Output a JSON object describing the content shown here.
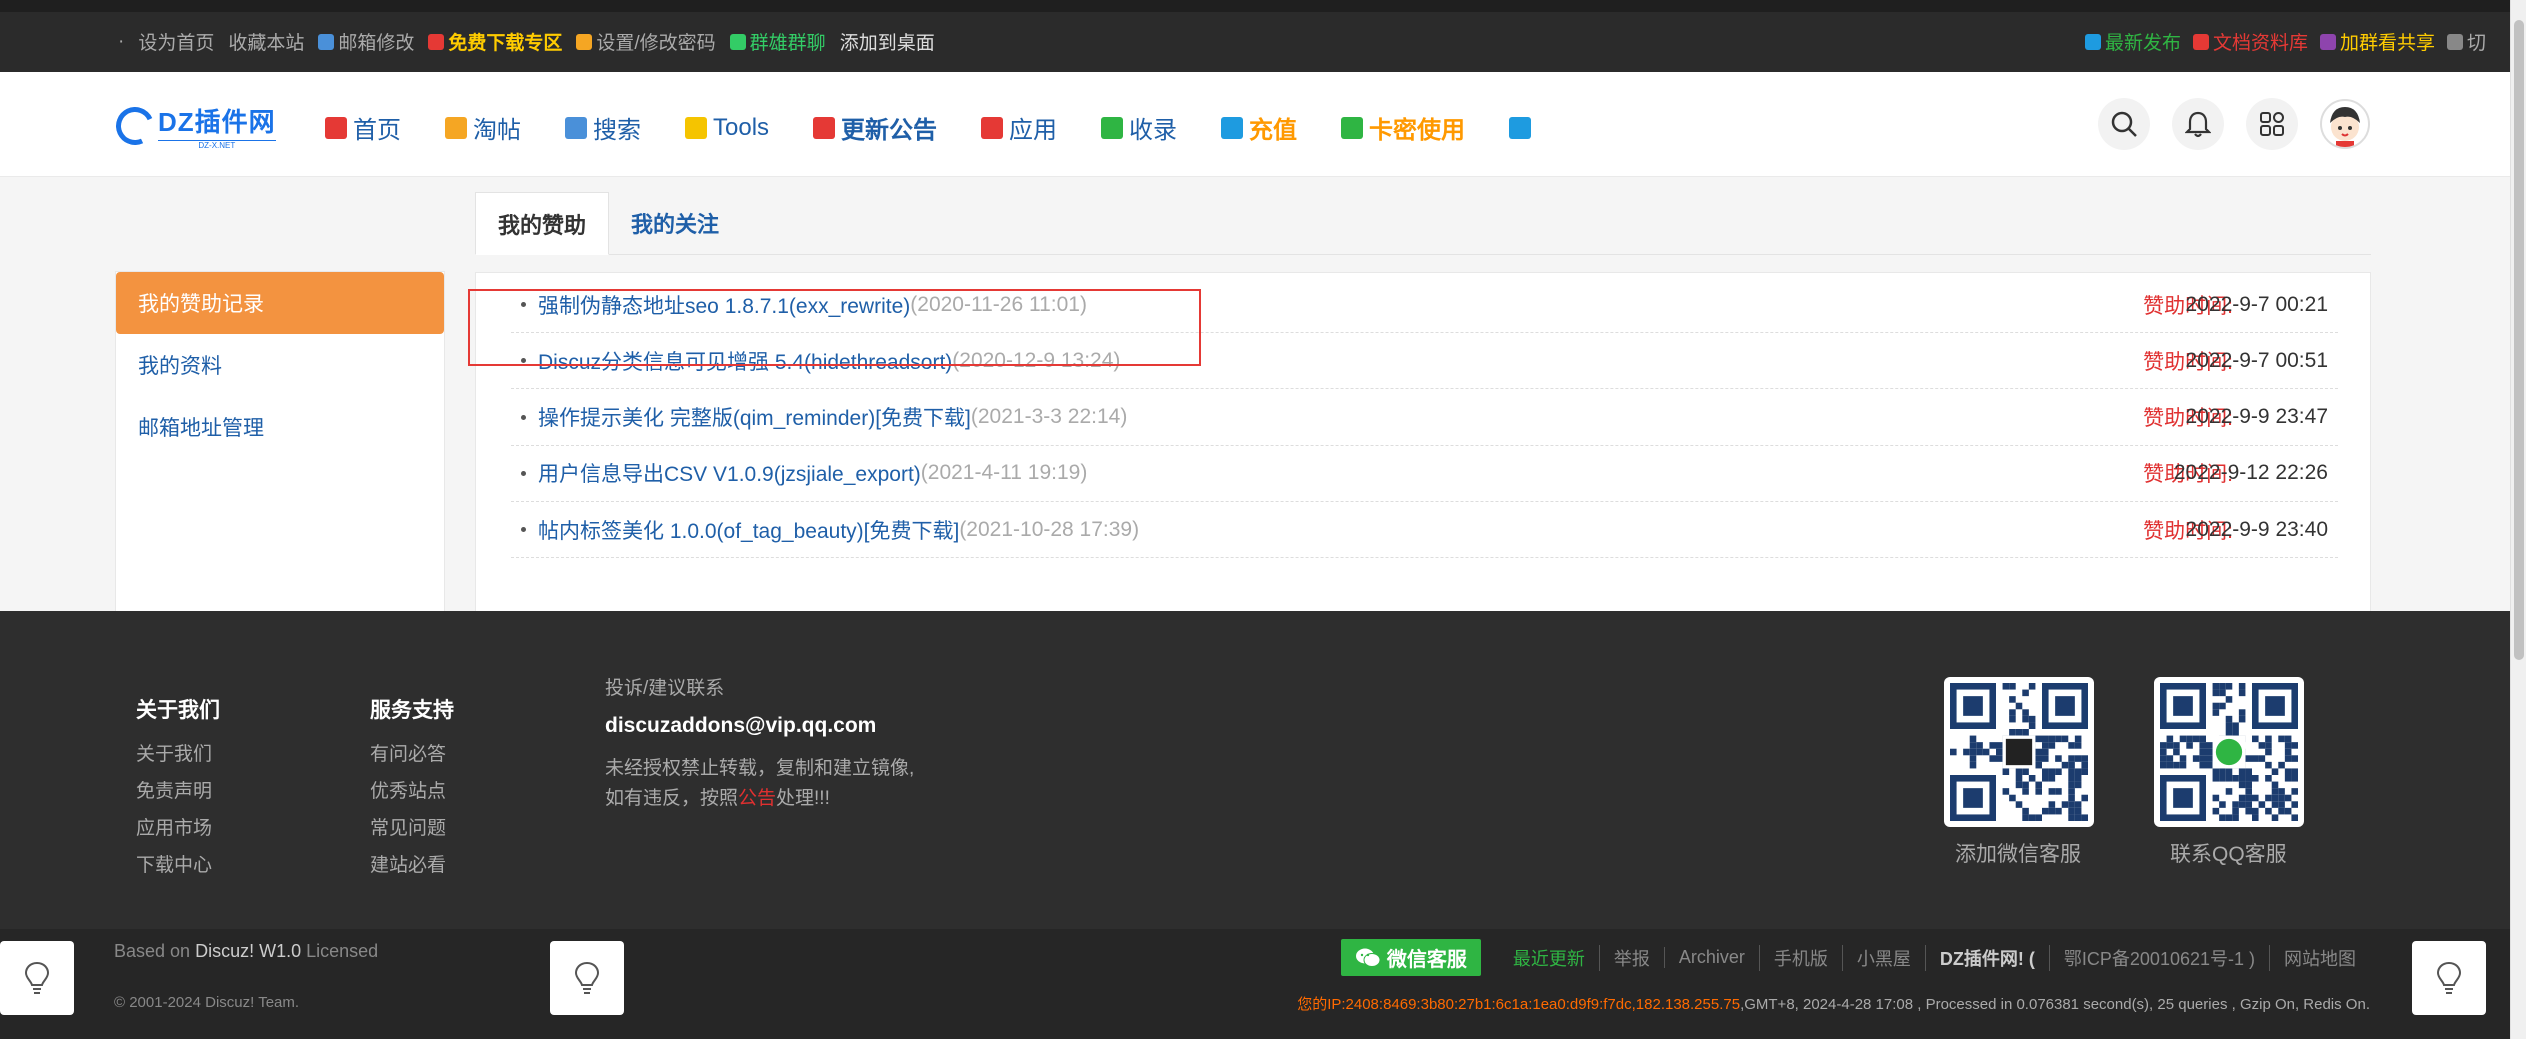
{
  "topbar": {
    "left": [
      {
        "label": "·",
        "color": "#aaaaaa"
      },
      {
        "label": "设为首页",
        "color": "#aaaaaa"
      },
      {
        "label": "收藏本站",
        "color": "#aaaaaa"
      },
      {
        "label": "邮箱修改",
        "color": "#aaaaaa",
        "icon": "mail-icon",
        "icon_color": "#4a90d9"
      },
      {
        "label": "免费下载专区",
        "color": "#ffcc00",
        "bold": true,
        "icon": "gift-icon",
        "icon_color": "#e53935"
      },
      {
        "label": "设置/修改密码",
        "color": "#aaaaaa",
        "icon": "lock-icon",
        "icon_color": "#f5a623"
      },
      {
        "label": "群雄群聊",
        "color": "#33cc66",
        "icon": "alien-icon",
        "icon_color": "#33cc66"
      },
      {
        "label": "添加到桌面",
        "color": "#dddddd"
      }
    ],
    "right": [
      {
        "label": "最新发布",
        "color": "#2fb543",
        "icon": "refresh-icon",
        "icon_color": "#1e9be0"
      },
      {
        "label": "文档资料库",
        "color": "#e53935",
        "icon": "document-icon",
        "icon_color": "#e53935"
      },
      {
        "label": "加群看共享",
        "color": "#ffcc00",
        "icon": "id-icon",
        "icon_color": "#8e44ad"
      },
      {
        "label": "切",
        "color": "#aaaaaa",
        "icon": "switch-icon",
        "icon_color": "#888888"
      }
    ]
  },
  "logo": {
    "text": "DZ插件网",
    "sub": "DZ-X.NET"
  },
  "nav": [
    {
      "label": "首页",
      "icon": "home-icon",
      "icon_color": "#e53935"
    },
    {
      "label": "淘帖",
      "icon": "rainbow-icon",
      "icon_color": "#f5a623"
    },
    {
      "label": "搜索",
      "icon": "hourglass-icon",
      "icon_color": "#4a90d9"
    },
    {
      "label": "Tools",
      "icon": "tag-icon",
      "icon_color": "#f5c400"
    },
    {
      "label": "更新公告",
      "icon": "megaphone-icon",
      "icon_color": "#e53935",
      "bold": true
    },
    {
      "label": "应用",
      "icon": "toolbox-icon",
      "icon_color": "#e53935"
    },
    {
      "label": "收录",
      "icon": "golf-icon",
      "icon_color": "#2fb543"
    },
    {
      "label": "充值",
      "icon": "atm-icon",
      "icon_color": "#1e9be0",
      "orange": true
    },
    {
      "label": "卡密使用",
      "icon": "checkmark-icon",
      "icon_color": "#2fb543",
      "orange": true
    },
    {
      "label": "",
      "icon": "return-icon",
      "icon_color": "#1e9be0"
    }
  ],
  "tabs": [
    "我的赞助",
    "我的关注"
  ],
  "sidebar": [
    "我的赞助记录",
    "我的资料",
    "邮箱地址管理"
  ],
  "sponsor_label": "赞助时间:",
  "records": [
    {
      "title": "强制伪静态地址seo 1.8.7.1(exx_rewrite)",
      "date": "(2020-11-26 11:01)",
      "time": "2022-9-7 00:21"
    },
    {
      "title": "Discuz分类信息可见增强 5.4(hidethreadsort)",
      "date": "(2020-12-9 13:24)",
      "time": "2022-9-7 00:51"
    },
    {
      "title": "操作提示美化 完整版(qim_reminder)[免费下载]",
      "date": "(2021-3-3 22:14)",
      "time": "2022-9-9 23:47"
    },
    {
      "title": "用户信息导出CSV V1.0.9(jzsjiale_export)",
      "date": "(2021-4-11 19:19)",
      "time": "2022-9-12 22:26"
    },
    {
      "title": "帖内标签美化 1.0.0(of_tag_beauty)[免费下载]",
      "date": "(2021-10-28 17:39)",
      "time": "2022-9-9 23:40"
    }
  ],
  "footer": {
    "col1": {
      "head": "关于我们",
      "links": [
        "关于我们",
        "免责声明",
        "应用市场",
        "下载中心"
      ]
    },
    "col2": {
      "head": "服务支持",
      "links": [
        "有问必答",
        "优秀站点",
        "常见问题",
        "建站必看"
      ]
    },
    "contact": {
      "label": "投诉/建议联系",
      "email": "discuzaddons@vip.qq.com",
      "line1": "未经授权禁止转载，复制和建立镜像,",
      "line2_a": "如有违反，按照",
      "line2_red": "公告",
      "line2_b": "处理!!!"
    },
    "qr1_label": "添加微信客服",
    "qr2_label": "联系QQ客服"
  },
  "bottom": {
    "based_prefix": "Based on",
    "based_product": "Discuz! W1.0",
    "based_suffix": "Licensed",
    "copyright": "© 2001-2024 Discuz! Team.",
    "wechat_button": "微信客服",
    "links": [
      {
        "label": "最近更新",
        "style": "green"
      },
      {
        "label": "举报",
        "style": ""
      },
      {
        "label": "Archiver",
        "style": ""
      },
      {
        "label": "手机版",
        "style": ""
      },
      {
        "label": "小黑屋",
        "style": ""
      },
      {
        "label": "DZ插件网! (",
        "style": "white"
      },
      {
        "label": "鄂ICP备20010621号-1 )",
        "style": ""
      },
      {
        "label": "网站地图",
        "style": ""
      }
    ],
    "ip_text": "您的IP:2408:8469:3b80:27b1:6c1a:1ea0:d9f9:f7dc,182.138.255.75",
    "server_text": ",GMT+8, 2024-4-28 17:08 , Processed in 0.076381 second(s), 25 queries , Gzip On, Redis On."
  }
}
